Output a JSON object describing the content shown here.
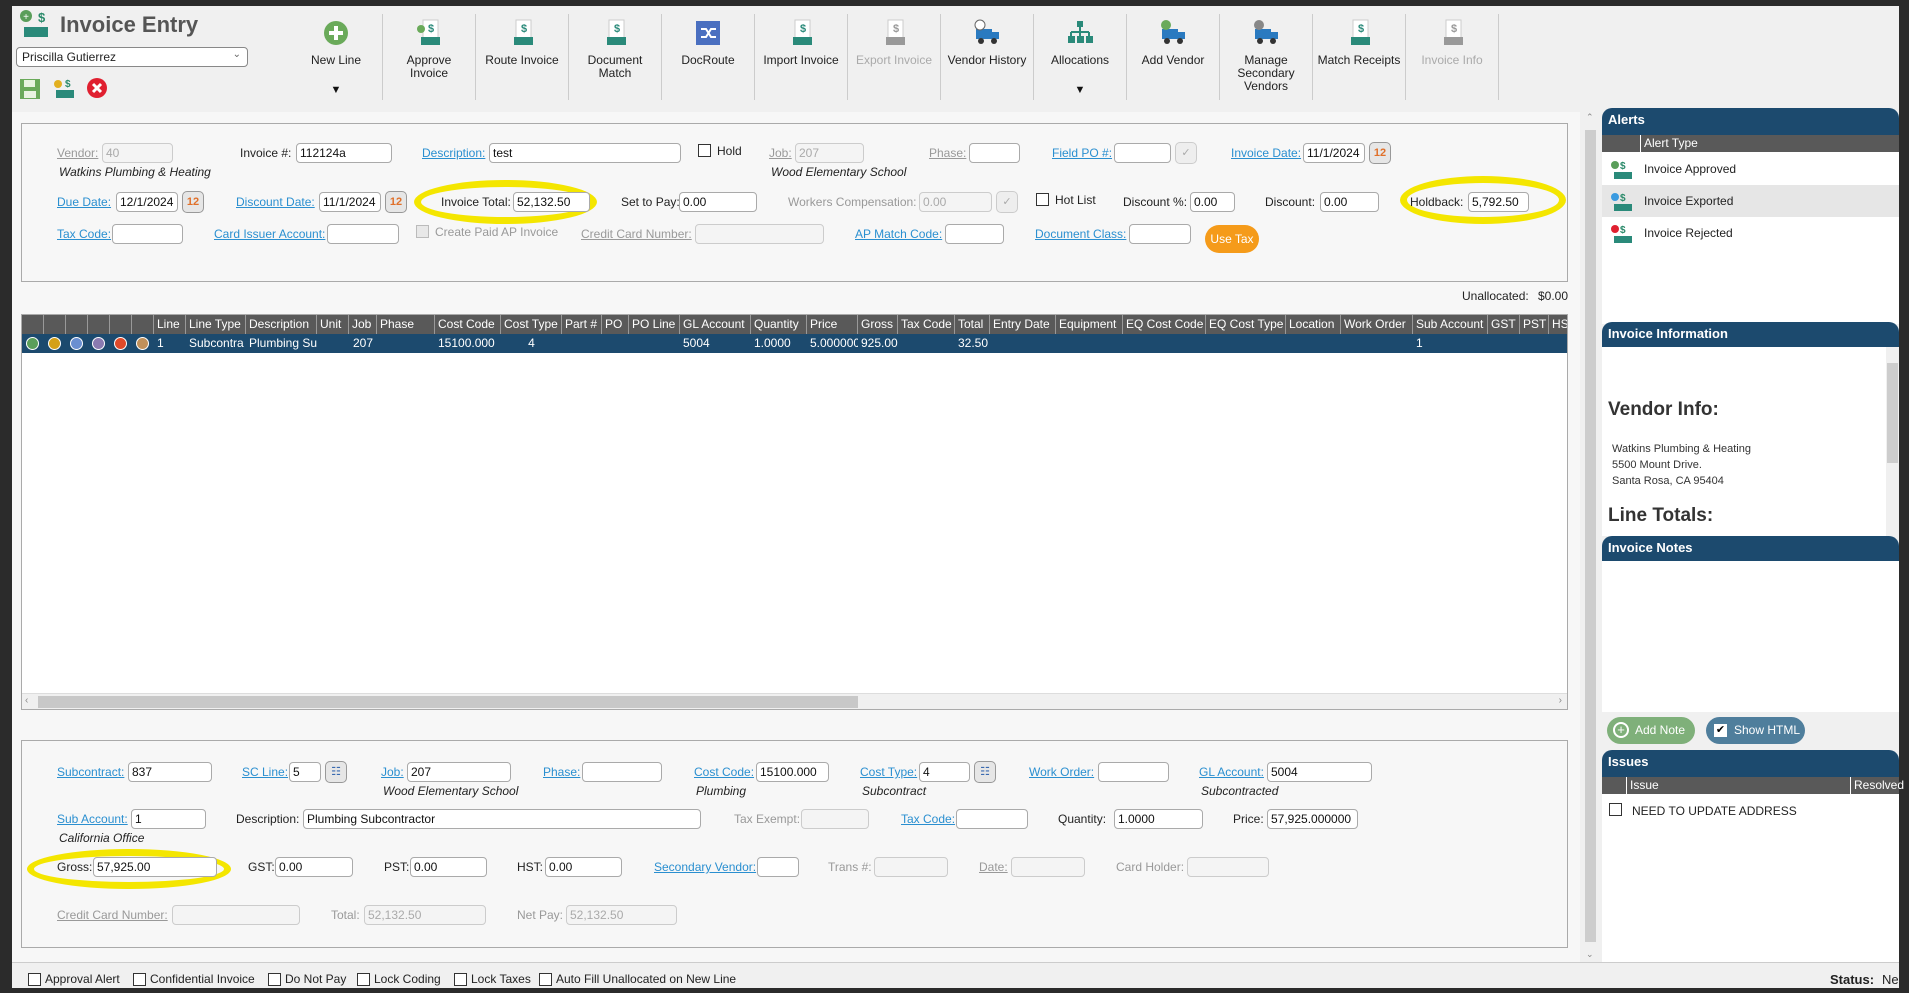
{
  "app": {
    "title": "Invoice Entry",
    "user": "Priscilla Gutierrez"
  },
  "toolbar": [
    {
      "label": "New Line",
      "icon": "plus-circle-icon",
      "dropdown": true,
      "disabled": false
    },
    {
      "label": "Approve Invoice",
      "icon": "approve-invoice-icon",
      "disabled": false
    },
    {
      "label": "Route Invoice",
      "icon": "route-invoice-icon",
      "disabled": false
    },
    {
      "label": "Document Match",
      "icon": "document-match-icon",
      "disabled": false
    },
    {
      "label": "DocRoute",
      "icon": "shuffle-icon",
      "disabled": false
    },
    {
      "label": "Import Invoice",
      "icon": "import-invoice-icon",
      "disabled": false
    },
    {
      "label": "Export Invoice",
      "icon": "export-invoice-icon",
      "disabled": true
    },
    {
      "label": "Vendor History",
      "icon": "truck-clock-icon",
      "disabled": false
    },
    {
      "label": "Allocations",
      "icon": "hierarchy-icon",
      "dropdown": true,
      "disabled": false
    },
    {
      "label": "Add Vendor",
      "icon": "truck-plus-icon",
      "disabled": false
    },
    {
      "label": "Manage Secondary Vendors",
      "icon": "truck-gear-icon",
      "disabled": false
    },
    {
      "label": "Match Receipts",
      "icon": "match-receipts-icon",
      "disabled": false
    },
    {
      "label": "Invoice Info",
      "icon": "invoice-info-icon",
      "disabled": true
    }
  ],
  "header": {
    "vendor": {
      "label": "Vendor:",
      "value": "40",
      "note": "Watkins Plumbing & Heating"
    },
    "invoice_no": {
      "label": "Invoice #:",
      "value": "112124a"
    },
    "description": {
      "label": "Description:",
      "value": "test"
    },
    "hold": {
      "label": "Hold",
      "checked": false
    },
    "job": {
      "label": "Job:",
      "value": "207",
      "note": "Wood Elementary School"
    },
    "phase": {
      "label": "Phase:",
      "value": ""
    },
    "field_po": {
      "label": "Field PO #:",
      "value": ""
    },
    "invoice_date": {
      "label": "Invoice Date:",
      "value": "11/1/2024"
    },
    "due_date": {
      "label": "Due Date:",
      "value": "12/1/2024"
    },
    "discount_date": {
      "label": "Discount Date:",
      "value": "11/1/2024"
    },
    "invoice_total": {
      "label": "Invoice Total:",
      "value": "52,132.50"
    },
    "set_to_pay": {
      "label": "Set to Pay:",
      "value": "0.00"
    },
    "workers_comp": {
      "label": "Workers Compensation:",
      "value": "0.00"
    },
    "hot_list": {
      "label": "Hot List",
      "checked": false
    },
    "discount_pct": {
      "label": "Discount %:",
      "value": "0.00"
    },
    "discount": {
      "label": "Discount:",
      "value": "0.00"
    },
    "holdback": {
      "label": "Holdback:",
      "value": "5,792.50"
    },
    "tax_code": {
      "label": "Tax Code:",
      "value": ""
    },
    "card_issuer": {
      "label": "Card Issuer Account:",
      "value": ""
    },
    "create_paid": {
      "label": "Create Paid AP Invoice",
      "checked": false
    },
    "credit_card": {
      "label": "Credit Card Number:",
      "value": ""
    },
    "ap_match": {
      "label": "AP Match Code:",
      "value": ""
    },
    "doc_class": {
      "label": "Document Class:",
      "value": ""
    },
    "use_tax": {
      "label": "Use Tax"
    }
  },
  "unallocated": {
    "label": "Unallocated:",
    "value": "$0.00"
  },
  "grid": {
    "columns": [
      "",
      "",
      "",
      "",
      "",
      "",
      "Line",
      "Line Type",
      "Description",
      "Unit",
      "Job",
      "Phase",
      "Cost Code",
      "Cost Type",
      "Part #",
      "PO",
      "PO Line",
      "GL Account",
      "Quantity",
      "Price",
      "Gross",
      "Tax Code",
      "Total",
      "Entry Date",
      "Equipment",
      "EQ Cost Code",
      "EQ Cost Type",
      "Location",
      "Work Order",
      "Sub Account",
      "GST",
      "PST",
      "HST"
    ],
    "row_icons": [
      "add-icon",
      "edit-icon",
      "copy-icon",
      "dollar-icon",
      "delete-icon",
      "help-icon"
    ],
    "rows": [
      [
        "1",
        "Subcontra",
        "Plumbing Su",
        "",
        "207",
        "",
        "15100.000",
        "4",
        "",
        "",
        "",
        "5004",
        "1.0000",
        "5.000000",
        "925.00",
        "",
        "32.50",
        "",
        "",
        "",
        "",
        "",
        "",
        "1",
        "",
        "",
        ""
      ]
    ]
  },
  "line": {
    "subcontract": {
      "label": "Subcontract:",
      "value": "837"
    },
    "sc_line": {
      "label": "SC Line:",
      "value": "5"
    },
    "job": {
      "label": "Job:",
      "value": "207",
      "note": "Wood Elementary School"
    },
    "phase": {
      "label": "Phase:",
      "value": ""
    },
    "cost_code": {
      "label": "Cost Code:",
      "value": "15100.000",
      "note": "Plumbing"
    },
    "cost_type": {
      "label": "Cost Type:",
      "value": "4",
      "note": "Subcontract"
    },
    "work_order": {
      "label": "Work Order:",
      "value": ""
    },
    "gl_account": {
      "label": "GL Account:",
      "value": "5004",
      "note": "Subcontracted"
    },
    "sub_account": {
      "label": "Sub Account:",
      "value": "1",
      "note": "California Office"
    },
    "description": {
      "label": "Description:",
      "value": "Plumbing Subcontractor"
    },
    "tax_exempt": {
      "label": "Tax Exempt:",
      "value": ""
    },
    "tax_code": {
      "label": "Tax Code:",
      "value": ""
    },
    "quantity": {
      "label": "Quantity:",
      "value": "1.0000"
    },
    "price": {
      "label": "Price:",
      "value": "57,925.000000"
    },
    "gross": {
      "label": "Gross:",
      "value": "57,925.00"
    },
    "gst": {
      "label": "GST:",
      "value": "0.00"
    },
    "pst": {
      "label": "PST:",
      "value": "0.00"
    },
    "hst": {
      "label": "HST:",
      "value": "0.00"
    },
    "secondary_vendor": {
      "label": "Secondary Vendor:",
      "value": ""
    },
    "trans_no": {
      "label": "Trans #:",
      "value": ""
    },
    "date": {
      "label": "Date:",
      "value": ""
    },
    "card_holder": {
      "label": "Card Holder:",
      "value": ""
    },
    "credit_card": {
      "label": "Credit Card Number:",
      "value": ""
    },
    "total": {
      "label": "Total:",
      "value": "52,132.50"
    },
    "net_pay": {
      "label": "Net Pay:",
      "value": "52,132.50"
    }
  },
  "options": [
    {
      "label": "Approval Alert",
      "checked": false
    },
    {
      "label": "Confidential Invoice",
      "checked": false
    },
    {
      "label": "Do Not Pay",
      "checked": false
    },
    {
      "label": "Lock Coding",
      "checked": false
    },
    {
      "label": "Lock Taxes",
      "checked": false
    },
    {
      "label": "Auto Fill Unallocated on New Line",
      "checked": false
    }
  ],
  "alerts": {
    "title": "Alerts",
    "column": "Alert Type",
    "items": [
      {
        "label": "Invoice Approved",
        "icon": "invoice-approved-icon"
      },
      {
        "label": "Invoice Exported",
        "icon": "invoice-exported-icon"
      },
      {
        "label": "Invoice Rejected",
        "icon": "invoice-rejected-icon"
      }
    ]
  },
  "invoice_info": {
    "title": "Invoice Information",
    "vendor_heading": "Vendor Info:",
    "vendor_lines": [
      "Watkins Plumbing & Heating",
      "5500 Mount Drive.",
      "Santa Rosa, CA 95404"
    ],
    "line_totals": "Line Totals:"
  },
  "notes": {
    "title": "Invoice Notes",
    "add_note": "Add Note",
    "show_html": "Show HTML",
    "show_html_checked": true
  },
  "issues": {
    "title": "Issues",
    "columns": [
      "Issue",
      "Resolved"
    ],
    "items": [
      {
        "text": "NEED TO UPDATE ADDRESS",
        "checked": false
      }
    ]
  },
  "status": {
    "label": "Status:",
    "value": "Ne"
  },
  "colors": {
    "panel_header": "#1c4a6e",
    "grid_header": "#595959",
    "link": "#2a8fd0",
    "use_tax": "#f59b1a",
    "highlight": "#f4e600",
    "add_note": "#7fb07a",
    "show_html": "#4f7e9c"
  }
}
